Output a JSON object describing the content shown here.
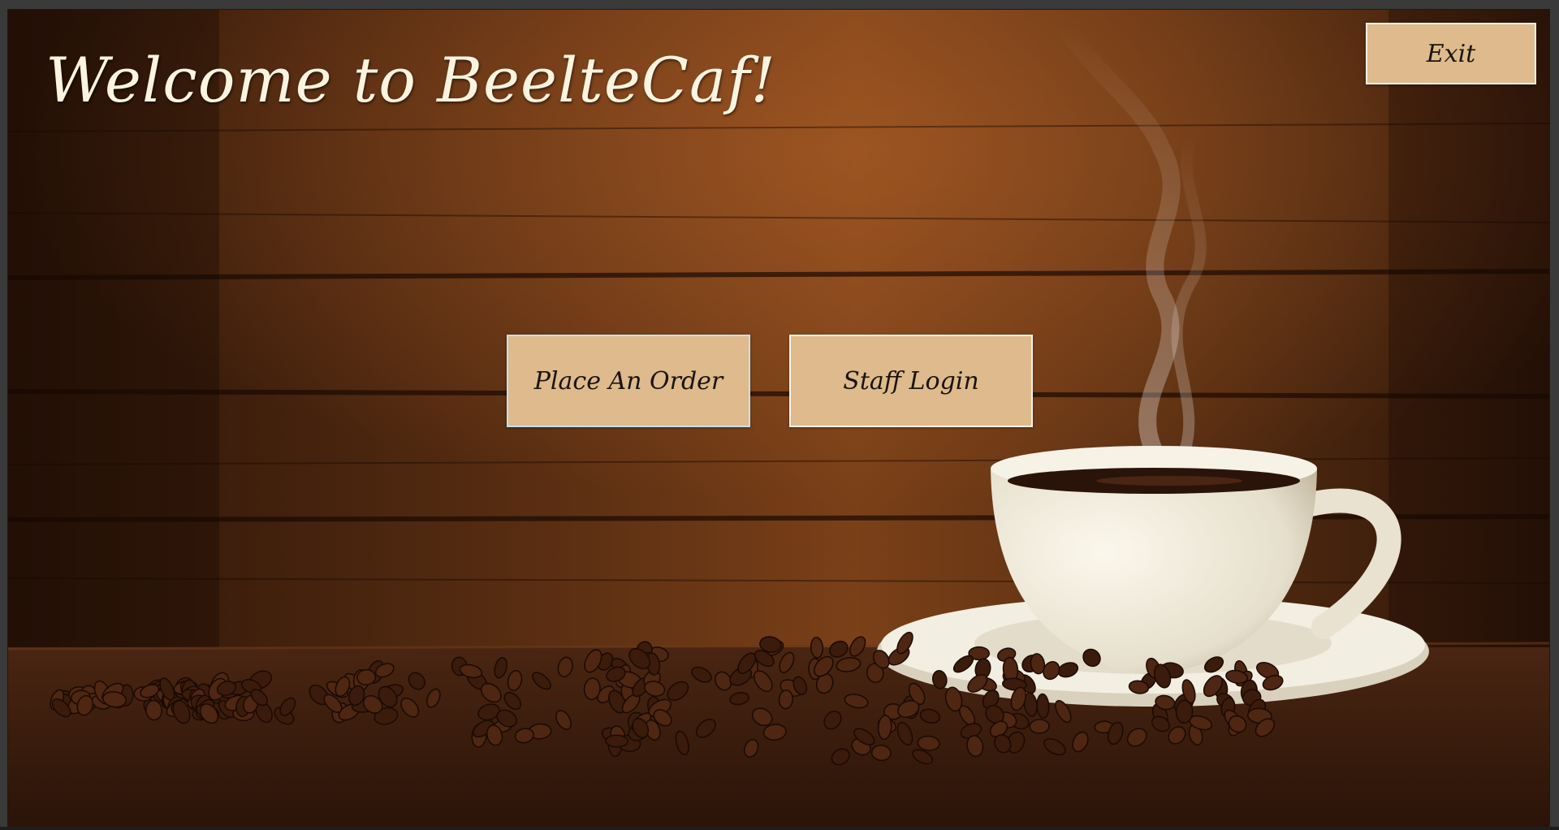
{
  "app": {
    "welcome_title": "Welcome to BeelteCaf!"
  },
  "buttons": {
    "exit_label": "Exit",
    "place_order_label": "Place An Order",
    "staff_login_label": "Staff Login"
  },
  "colors": {
    "button_fill": "#deba8c",
    "title_text": "#fbf4e0",
    "wood_dark": "#2a1408",
    "wood_light": "#8a4a1c"
  },
  "background": {
    "scene": "coffee-cup-on-wood-with-beans-and-steam"
  }
}
